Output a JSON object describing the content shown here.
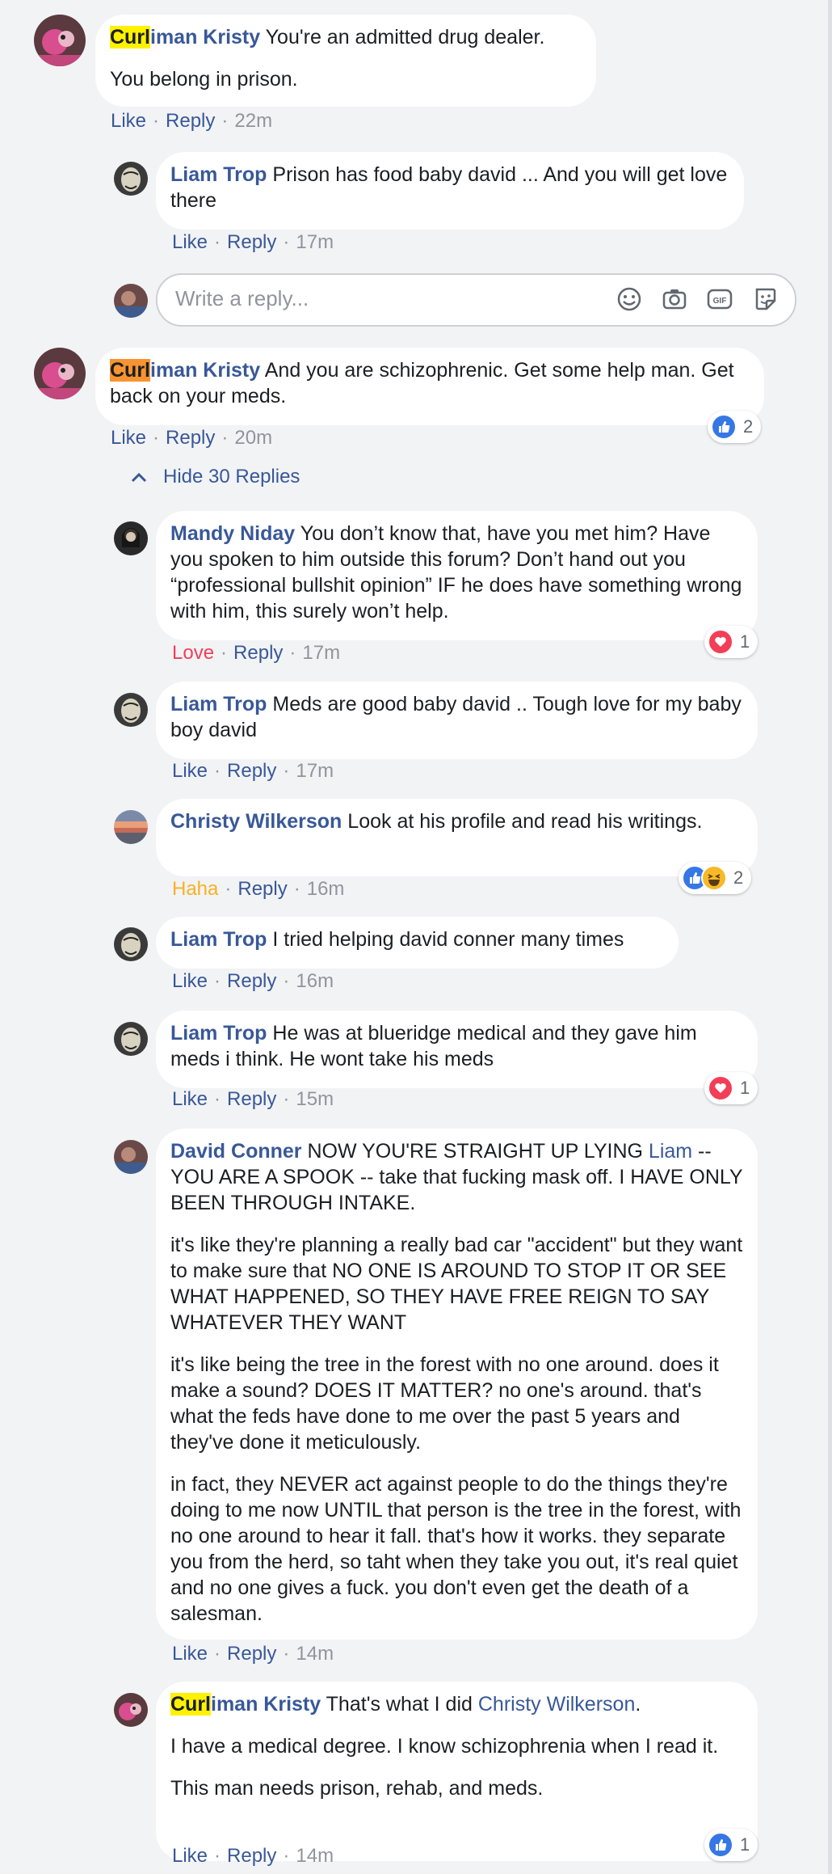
{
  "c1": {
    "name_hl": "Curl",
    "name_rest": "iman Kristy",
    "text1": " You're an admitted drug dealer.",
    "text2": "You belong in prison.",
    "like": "Like",
    "reply": "Reply",
    "time": "22m"
  },
  "c2": {
    "name": "Liam Trop",
    "text": " Prison has food baby david ... And you will get love there",
    "like": "Like",
    "reply": "Reply",
    "time": "17m"
  },
  "reply_box": {
    "placeholder": "Write a reply...",
    "icons": [
      "emoji-icon",
      "camera-icon",
      "gif-icon",
      "sticker-icon"
    ]
  },
  "c3": {
    "name_hl": "Curl",
    "name_rest": "iman Kristy",
    "text": " And you are schizophrenic. Get some help man. Get back on your meds.",
    "like": "Like",
    "reply": "Reply",
    "time": "20m",
    "reaction_count": "2"
  },
  "hide_replies": "Hide 30 Replies",
  "c4": {
    "name": "Mandy Niday",
    "text": " You don’t know that, have you met him? Have you spoken to him outside this forum? Don’t hand out you “professional bullshit opinion” IF he does have something wrong with him, this surely won’t help.",
    "like": "Love",
    "reply": "Reply",
    "time": "17m",
    "reaction_count": "1"
  },
  "c5": {
    "name": "Liam Trop",
    "text": " Meds are good baby david .. Tough love for my baby boy david",
    "like": "Like",
    "reply": "Reply",
    "time": "17m"
  },
  "c6": {
    "name": "Christy Wilkerson",
    "text": " Look at his profile and read his writings.",
    "like": "Haha",
    "reply": "Reply",
    "time": "16m",
    "reaction_count": "2"
  },
  "c7": {
    "name": "Liam Trop",
    "text": " I tried helping david conner many times",
    "like": "Like",
    "reply": "Reply",
    "time": "16m"
  },
  "c8": {
    "name": "Liam Trop",
    "text": " He was at blueridge medical and they gave him meds i think. He wont take his meds",
    "like": "Like",
    "reply": "Reply",
    "time": "15m",
    "reaction_count": "1"
  },
  "c9": {
    "name": "David Conner",
    "text_a": " NOW YOU'RE STRAIGHT UP LYING ",
    "mention": "Liam",
    "text_b": " -- YOU ARE A SPOOK -- take that fucking mask off. I HAVE ONLY BEEN THROUGH INTAKE.",
    "p2": "it's like they're planning a really bad car \"accident\" but they want to make sure that NO ONE IS AROUND TO STOP IT OR SEE WHAT HAPPENED, SO THEY HAVE FREE REIGN TO SAY WHATEVER THEY WANT",
    "p3": "it's like being the tree in the forest with no one around. does it make a sound? DOES IT MATTER? no one's around. that's what the feds have done to me over the past 5 years and they've done it meticulously.",
    "p4": "in fact, they NEVER act against people to do the things they're doing to me now UNTIL that person is the tree in the forest, with no one around to hear it fall. that's how it works. they separate you from the herd, so taht when they take you out, it's real quiet and no one gives a fuck. you don't even get the death of a salesman.",
    "like": "Like",
    "reply": "Reply",
    "time": "14m"
  },
  "c10": {
    "name_hl": "Curl",
    "name_rest": "iman Kristy",
    "text_a": " That's what I did ",
    "mention": "Christy Wilkerson",
    "text_b": ".",
    "p2": "I have a medical degree. I know schizophrenia when I read it.",
    "p3": "This man needs prison, rehab, and meds.",
    "like": "Like",
    "reply": "Reply",
    "time": "14m",
    "reaction_count": "1"
  },
  "colors": {
    "link": "#385898",
    "bubble": "#ffffff",
    "background": "#f2f3f5",
    "highlight_yellow": "#fff200",
    "highlight_orange": "#f79431",
    "love": "#f33e58",
    "haha": "#f7b125",
    "like_blue": "#3578e5"
  }
}
